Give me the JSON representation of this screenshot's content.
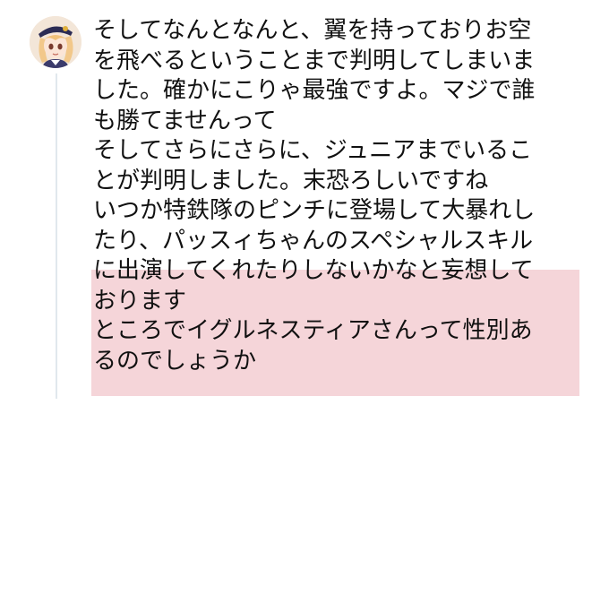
{
  "colors": {
    "background": "#ffffff",
    "text": "#111111",
    "highlight": "#f5d5d9",
    "thread_line": "#e1e8ed"
  },
  "post": {
    "avatar_icon": "character-avatar-icon",
    "lines": [
      "そしてなんとなんと、翼を持っておりお空",
      "を飛べるということまで判明してしまいま",
      "した。確かにこりゃ最強ですよ。マジで誰",
      "も勝てませんって",
      "そしてさらにさらに、ジュニアまでいるこ",
      "とが判明しました。末恐ろしいですね",
      "いつか特鉄隊のピンチに登場して大暴れし",
      "たり、パッスィちゃんのスペシャルスキル",
      "に出演してくれたりしないかなと妄想して",
      "おります",
      "ところでイグルネスティアさんって性別あ",
      "るのでしょうか"
    ]
  }
}
